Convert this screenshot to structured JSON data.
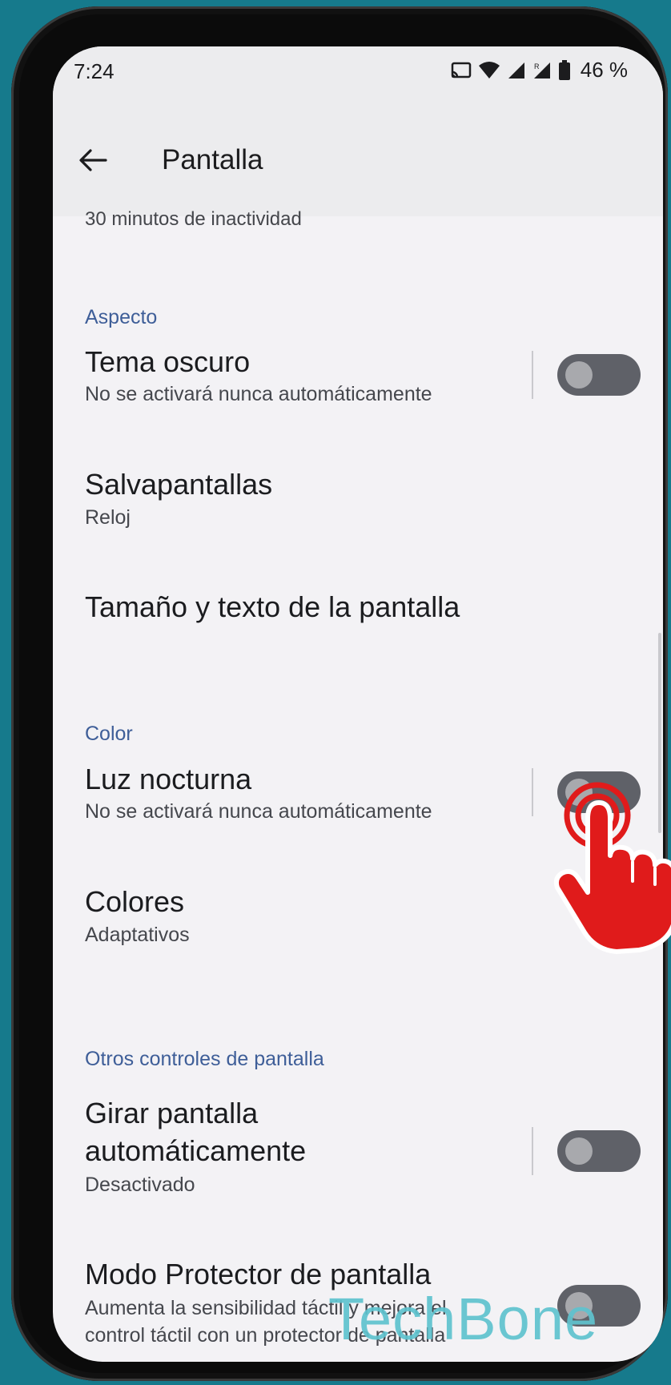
{
  "status_bar": {
    "time": "7:24",
    "battery": "46 %",
    "icons": [
      "cast-icon",
      "wifi-icon",
      "signal-icon",
      "signal-roaming-icon",
      "battery-icon"
    ]
  },
  "app_bar": {
    "title": "Pantalla",
    "back_icon": "arrow-left-icon"
  },
  "truncated_item_subtitle": "30 minutos de inactividad",
  "sections": {
    "aspecto": {
      "header": "Aspecto",
      "tema_oscuro": {
        "title": "Tema oscuro",
        "subtitle": "No se activará nunca automáticamente",
        "toggle_on": false
      },
      "salvapantallas": {
        "title": "Salvapantallas",
        "subtitle": "Reloj"
      },
      "tamano_texto": {
        "title": "Tamaño y texto de la pantalla"
      }
    },
    "color": {
      "header": "Color",
      "luz_nocturna": {
        "title": "Luz nocturna",
        "subtitle": "No se activará nunca automáticamente",
        "toggle_on": false
      },
      "colores": {
        "title": "Colores",
        "subtitle": "Adaptativos"
      }
    },
    "otros": {
      "header": "Otros controles de pantalla",
      "girar": {
        "title_line1": "Girar pantalla",
        "title_line2": "automáticamente",
        "subtitle": "Desactivado",
        "toggle_on": false
      },
      "protector": {
        "title": "Modo Protector de pantalla",
        "subtitle_line1": "Aumenta la sensibilidad táctil y mejora el",
        "subtitle_line2": "control táctil con un protector de pantalla",
        "toggle_on": false
      }
    }
  },
  "colors": {
    "background": "#167a8c",
    "screen": "#f3f2f5",
    "section_header": "#3e5e98",
    "toggle_track_off": "#5f6168",
    "hand_pointer": "#e01b1b",
    "watermark": "#5fc3cf"
  },
  "overlay": {
    "pointer_icon": "hand-pointer-icon",
    "watermark": "TechBone"
  }
}
